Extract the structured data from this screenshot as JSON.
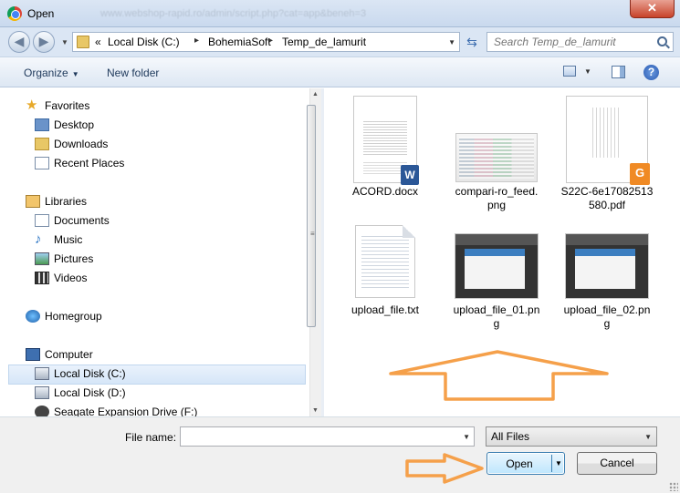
{
  "window": {
    "title": "Open",
    "ghost_url": "www.webshop-rapid.ro/admin/script.php?cat=app&beneh=3",
    "close_label": "✕"
  },
  "address": {
    "prefix": "«",
    "crumbs": [
      "Local Disk (C:)",
      "BohemiaSoft",
      "Temp_de_lamurit"
    ],
    "separator": "▸"
  },
  "search": {
    "placeholder": "Search Temp_de_lamurit"
  },
  "toolbar": {
    "organize": "Organize",
    "new_folder": "New folder",
    "help": "?"
  },
  "nav": {
    "items": [
      {
        "label": "Favorites",
        "icon": "star-icon"
      },
      {
        "label": "Desktop",
        "icon": "desktop-icon"
      },
      {
        "label": "Downloads",
        "icon": "downloads-folder-icon"
      },
      {
        "label": "Recent Places",
        "icon": "recent-places-icon"
      },
      {
        "label": "Libraries",
        "icon": "libraries-icon"
      },
      {
        "label": "Documents",
        "icon": "documents-icon"
      },
      {
        "label": "Music",
        "icon": "music-icon"
      },
      {
        "label": "Pictures",
        "icon": "pictures-icon"
      },
      {
        "label": "Videos",
        "icon": "videos-icon"
      },
      {
        "label": "Homegroup",
        "icon": "homegroup-icon"
      },
      {
        "label": "Computer",
        "icon": "computer-icon"
      },
      {
        "label": "Local Disk (C:)",
        "icon": "disk-icon",
        "selected": true
      },
      {
        "label": "Local Disk (D:)",
        "icon": "disk-icon"
      },
      {
        "label": "Seagate Expansion Drive (F:)",
        "icon": "external-drive-icon"
      }
    ]
  },
  "files": [
    {
      "name1": "ACORD.docx",
      "name2": "",
      "kind": "word-document"
    },
    {
      "name1": "compari-ro_feed.",
      "name2": "png",
      "kind": "image"
    },
    {
      "name1": "S22C-6e17082513",
      "name2": "580.pdf",
      "kind": "pdf"
    },
    {
      "name1": "upload_file.txt",
      "name2": "",
      "kind": "text"
    },
    {
      "name1": "upload_file_01.pn",
      "name2": "g",
      "kind": "image"
    },
    {
      "name1": "upload_file_02.pn",
      "name2": "g",
      "kind": "image"
    }
  ],
  "bottom": {
    "file_name_label": "File name:",
    "file_name_value": "",
    "file_type": "All Files",
    "open_label": "Open",
    "cancel_label": "Cancel"
  },
  "colors": {
    "arrow": "#f5a04a",
    "accent": "#3c7fb1"
  }
}
